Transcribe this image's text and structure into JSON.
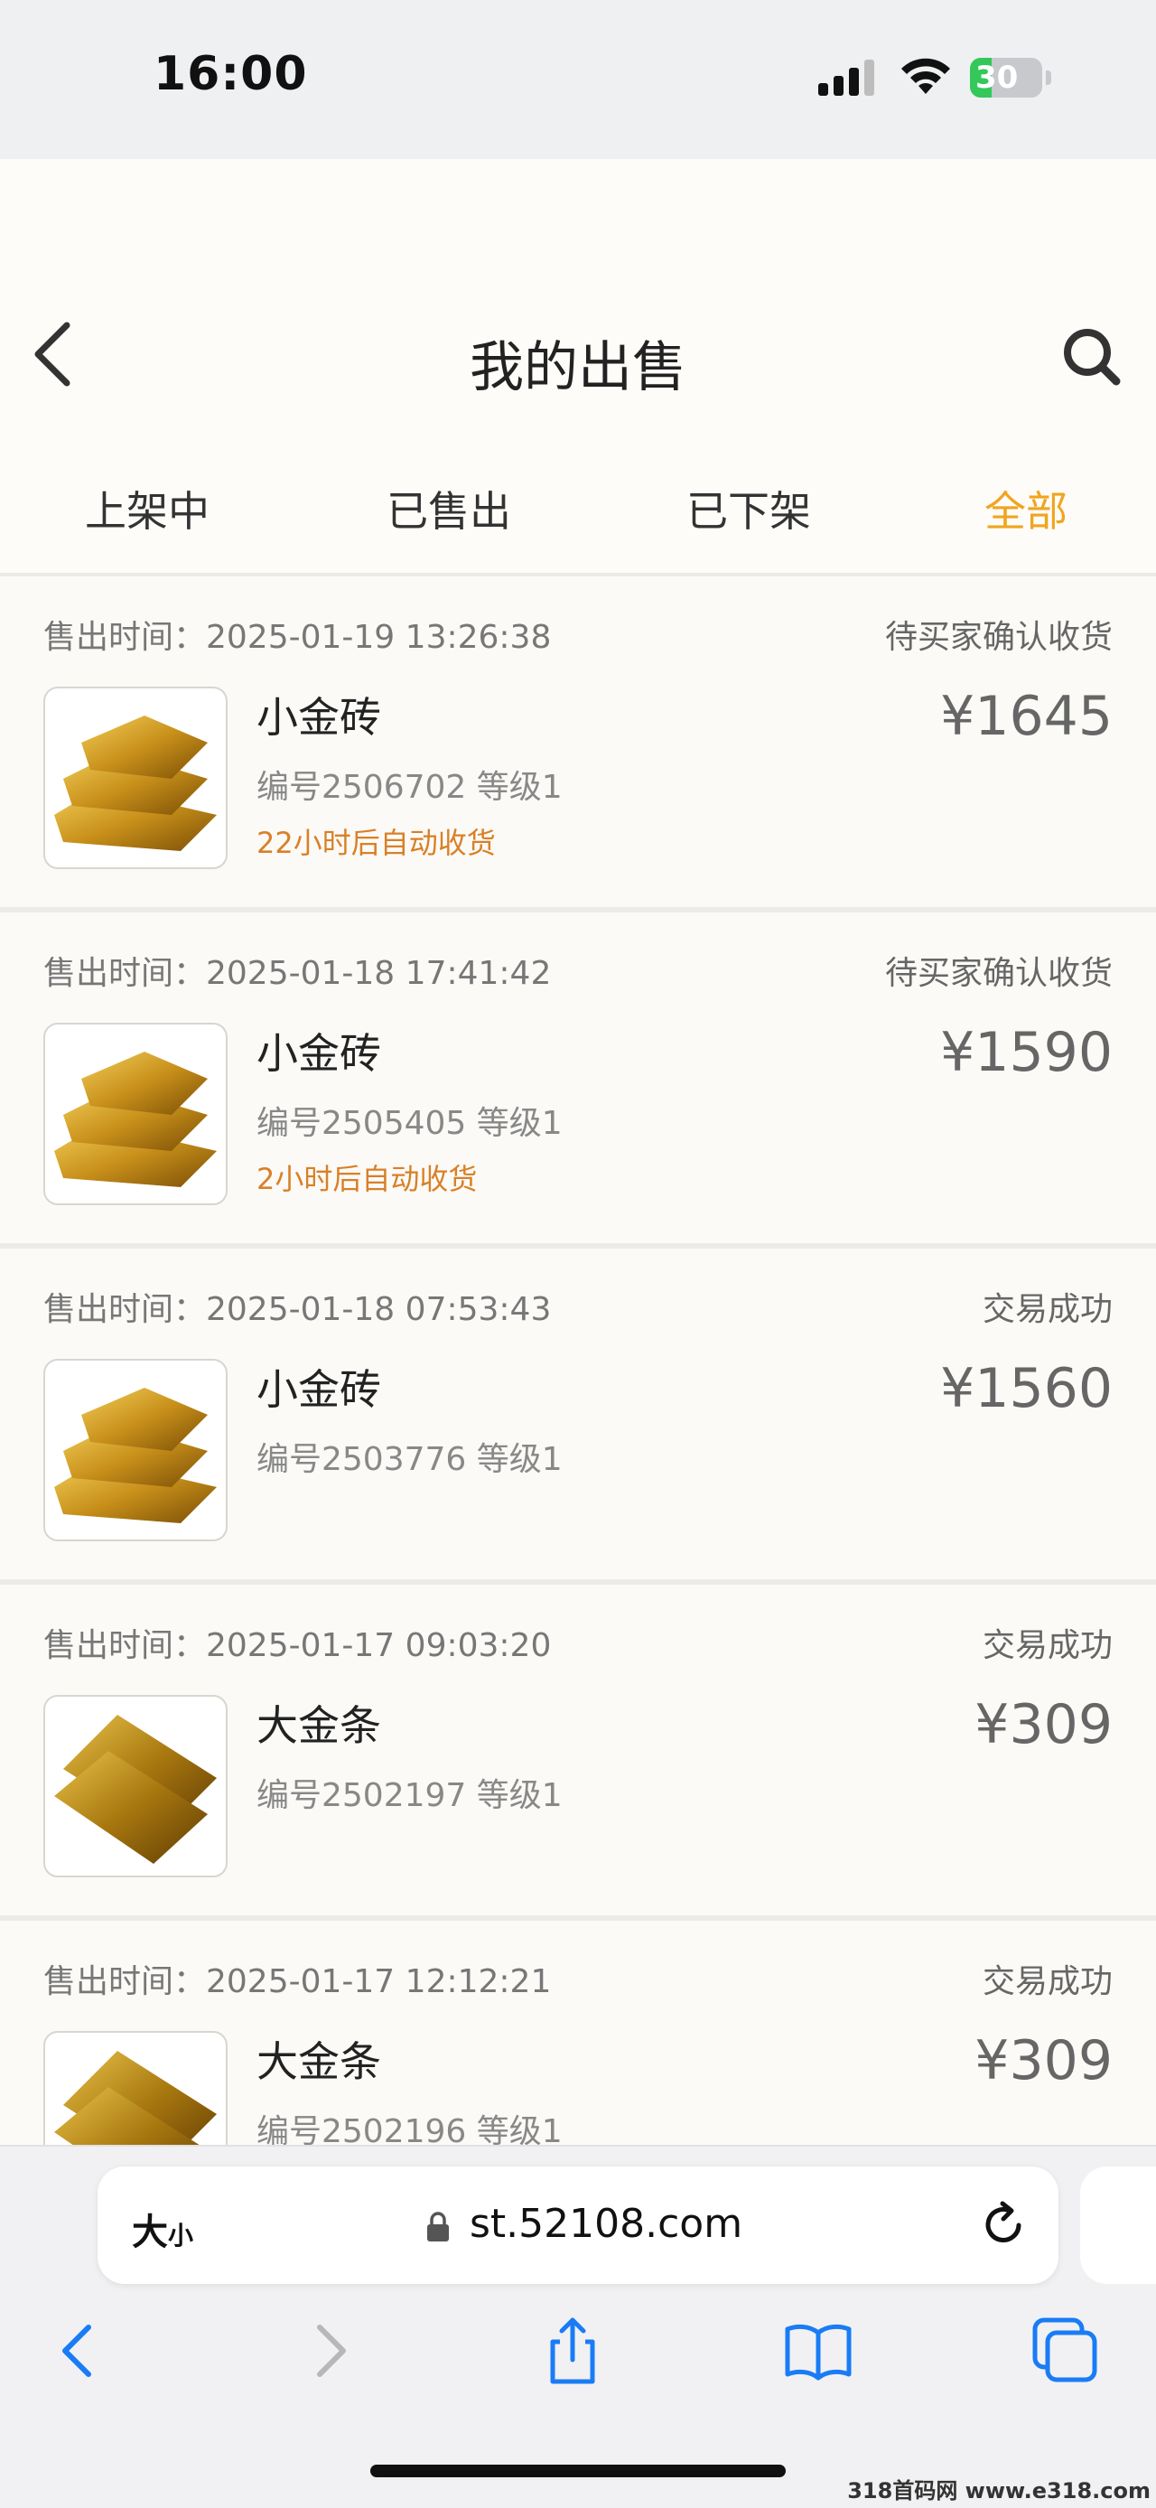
{
  "status_bar": {
    "time": "16:00",
    "battery": "30",
    "battery_level": 0.3,
    "icons": [
      "signal-icon",
      "wifi-icon",
      "battery-charging-icon"
    ]
  },
  "header": {
    "title": "我的出售",
    "back_icon": "chevron-left-icon",
    "search_icon": "search-icon"
  },
  "tabs": [
    {
      "label": "上架中",
      "active": false
    },
    {
      "label": "已售出",
      "active": false
    },
    {
      "label": "已下架",
      "active": false
    },
    {
      "label": "全部",
      "active": true
    }
  ],
  "colors": {
    "accent": "#f0a51e",
    "note": "#d98027",
    "status_bar_bg": "#eef0f2",
    "page_bg": "#fbfaf7"
  },
  "orders": [
    {
      "time": "售出时间：2025-01-19 13:26:38",
      "status": "待买家确认收货",
      "name": "小金砖",
      "meta": "编号2506702   等级1",
      "note": "22小时后自动收货",
      "price": "¥1645",
      "thumb": "gold-brick-icon"
    },
    {
      "time": "售出时间：2025-01-18 17:41:42",
      "status": "待买家确认收货",
      "name": "小金砖",
      "meta": "编号2505405   等级1",
      "note": "2小时后自动收货",
      "price": "¥1590",
      "thumb": "gold-brick-icon"
    },
    {
      "time": "售出时间：2025-01-18 07:53:43",
      "status": "交易成功",
      "name": "小金砖",
      "meta": "编号2503776   等级1",
      "note": "",
      "price": "¥1560",
      "thumb": "gold-brick-icon"
    },
    {
      "time": "售出时间：2025-01-17 09:03:20",
      "status": "交易成功",
      "name": "大金条",
      "meta": "编号2502197   等级1",
      "note": "",
      "price": "¥309",
      "thumb": "gold-bar-icon"
    },
    {
      "time": "售出时间：2025-01-17 12:12:21",
      "status": "交易成功",
      "name": "大金条",
      "meta": "编号2502196   等级1",
      "note": "",
      "price": "¥309",
      "thumb": "gold-bar-icon"
    }
  ],
  "browser": {
    "text_size": "大",
    "text_size_small": "小",
    "url": "st.52108.com",
    "icons": [
      "lock-icon",
      "reload-icon",
      "back-icon",
      "forward-icon",
      "share-icon",
      "bookmarks-icon",
      "tabs-icon"
    ]
  },
  "watermark": "318首码网 www.e318.com"
}
